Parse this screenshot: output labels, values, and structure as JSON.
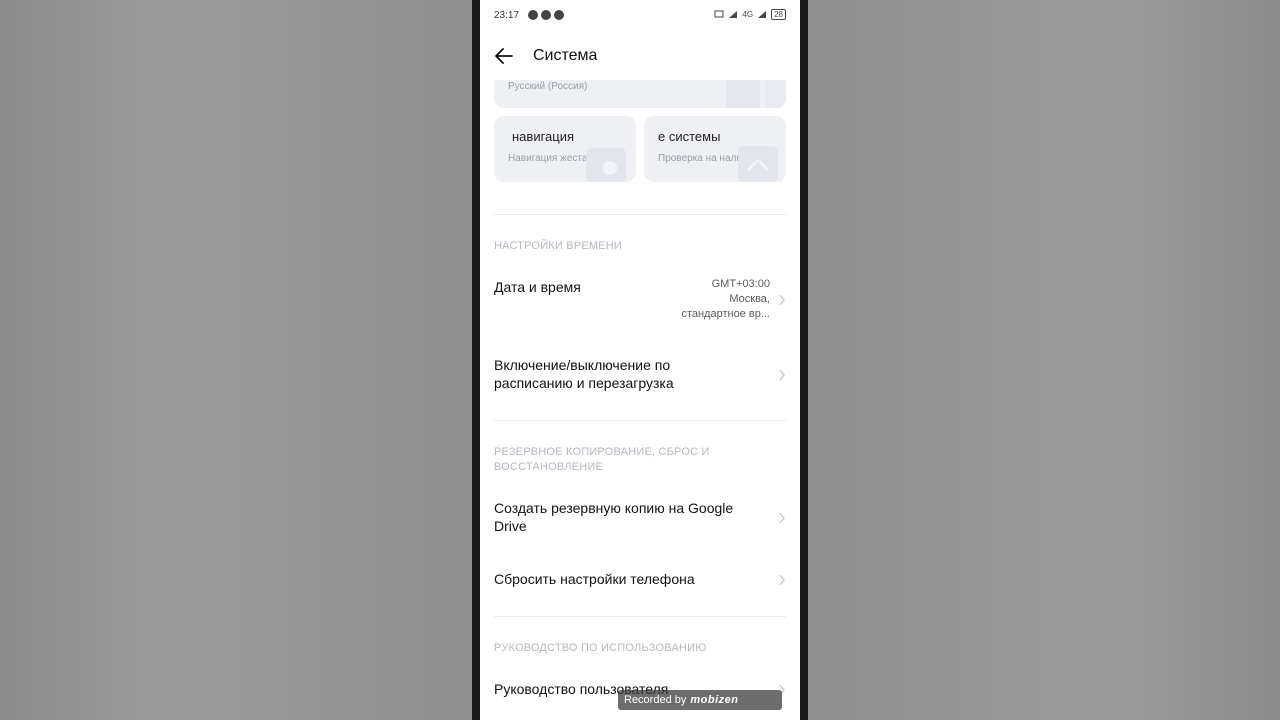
{
  "status_bar": {
    "time": "23:17",
    "network": "4G",
    "battery": "28"
  },
  "header": {
    "title": "Система",
    "back_icon": "arrow-left-icon"
  },
  "language_card": {
    "subtitle": "Русский (Россия)"
  },
  "quick_cards": [
    {
      "title": "навигация",
      "subtitle": "Навигация жестами"
    },
    {
      "title": "е системы",
      "subtitle": "Проверка на наличи..."
    }
  ],
  "sections": {
    "time": {
      "header": "НАСТРОЙКИ ВРЕМЕНИ",
      "date_time": {
        "label": "Дата и время",
        "value_line1": "GMT+03:00",
        "value_line2": "Москва,",
        "value_line3": "стандартное вр..."
      },
      "schedule": {
        "label_line1": "Включение/выключение по",
        "label_line2": "расписанию и перезагрузка"
      }
    },
    "backup": {
      "header_line1": "РЕЗЕРВНОЕ КОПИРОВАНИЕ, СБРОС И",
      "header_line2": "ВОССТАНОВЛЕНИЕ",
      "google_backup": {
        "label_line1": "Создать резервную копию на Google",
        "label_line2": "Drive"
      },
      "reset": {
        "label": "Сбросить настройки телефона"
      }
    },
    "guide": {
      "header": "РУКОВОДСТВО ПО ИСПОЛЬЗОВАНИЮ",
      "user_guide": {
        "label": "Руководство пользователя"
      }
    }
  },
  "overlay": {
    "recorded_by": "Recorded by",
    "brand": "mobizen"
  },
  "colors": {
    "background_blur": "#8a8a8a",
    "screen_bg": "#ffffff",
    "card_bg": "#eef0f4",
    "section_header": "#b4b7bd"
  }
}
